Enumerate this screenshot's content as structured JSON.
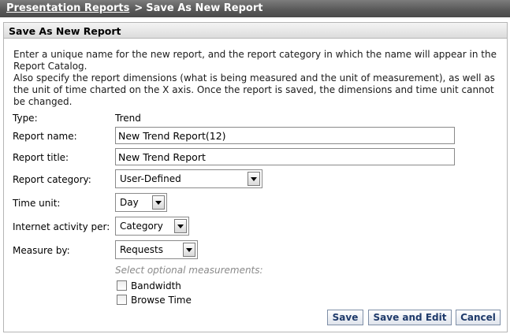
{
  "breadcrumb": {
    "link": "Presentation Reports",
    "separator": ">",
    "current": "Save As New Report"
  },
  "panel": {
    "title": "Save As New Report",
    "intro_1": "Enter a unique name for the new report, and the report category in which the name will appear in the Report Catalog.",
    "intro_2": "Also specify the report dimensions (what is being measured and the unit of measurement), as well as the unit of time charted on the X axis. Once the report is saved, the dimensions and time unit cannot be changed."
  },
  "form": {
    "type_label": "Type:",
    "type_value": "Trend",
    "report_name_label": "Report name:",
    "report_name_value": "New Trend Report(12)",
    "report_title_label": "Report title:",
    "report_title_value": "New Trend Report",
    "report_category_label": "Report category:",
    "report_category_value": "User-Defined",
    "time_unit_label": "Time unit:",
    "time_unit_value": "Day",
    "internet_activity_label": "Internet activity per:",
    "internet_activity_value": "Category",
    "measure_by_label": "Measure by:",
    "measure_by_value": "Requests",
    "optional_hint": "Select optional measurements:",
    "bandwidth_label": "Bandwidth",
    "bandwidth_checked": false,
    "browse_time_label": "Browse Time",
    "browse_time_checked": false
  },
  "buttons": {
    "save": "Save",
    "save_and_edit": "Save and Edit",
    "cancel": "Cancel"
  },
  "colors": {
    "titlebar": "#5a5a5a",
    "button_text": "#1f3a6a",
    "hint_text": "#8a8a8a"
  }
}
